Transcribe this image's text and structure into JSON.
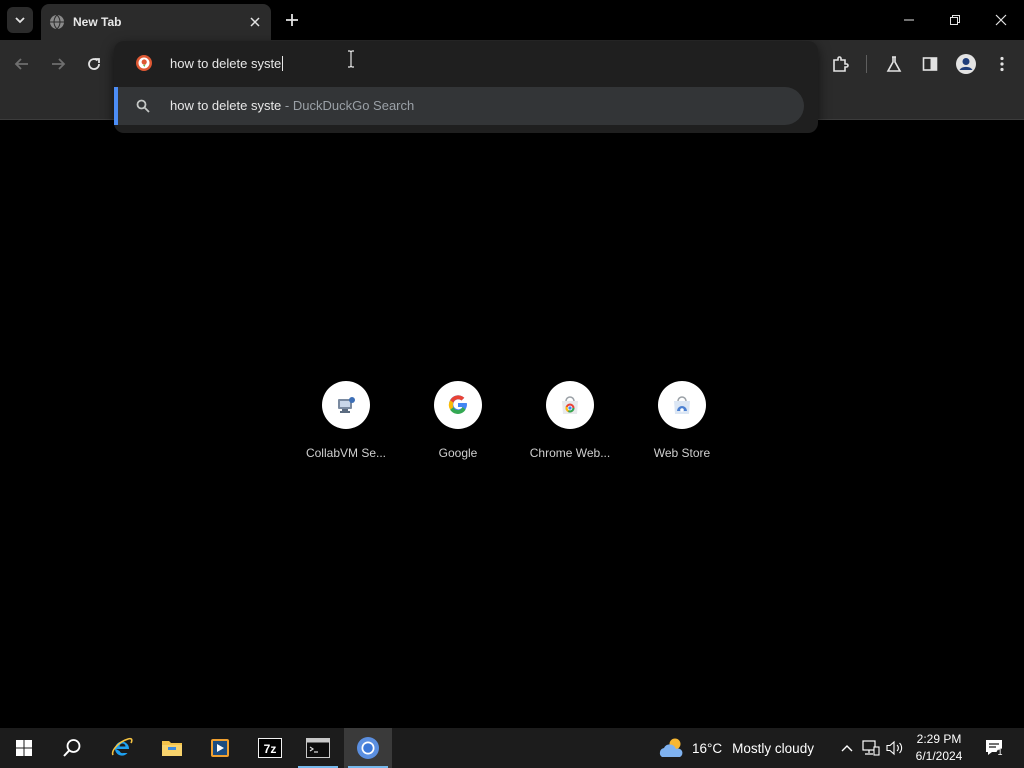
{
  "browser": {
    "tab": {
      "title": "New Tab"
    },
    "omnibox": {
      "input_value": "how to delete syste",
      "suggestion": {
        "query": "how to delete syste",
        "separator": " - ",
        "provider": "DuckDuckGo Search"
      }
    },
    "shortcuts": [
      {
        "label": "CollabVM Se...",
        "icon": "collabvm-icon"
      },
      {
        "label": "Google",
        "icon": "google-icon"
      },
      {
        "label": "Chrome Web...",
        "icon": "chrome-web-store-icon"
      },
      {
        "label": "Web Store",
        "icon": "web-store-icon"
      }
    ]
  },
  "taskbar": {
    "weather": {
      "temperature": "16°C",
      "condition": "Mostly cloudy"
    },
    "clock": {
      "time": "2:29 PM",
      "date": "6/1/2024"
    },
    "notification_count": "1"
  },
  "colors": {
    "accent": "#4c8df6",
    "toolbar_bg": "#2b2b2b",
    "page_bg": "#000000",
    "taskbar_bg": "#1c1c1c"
  }
}
